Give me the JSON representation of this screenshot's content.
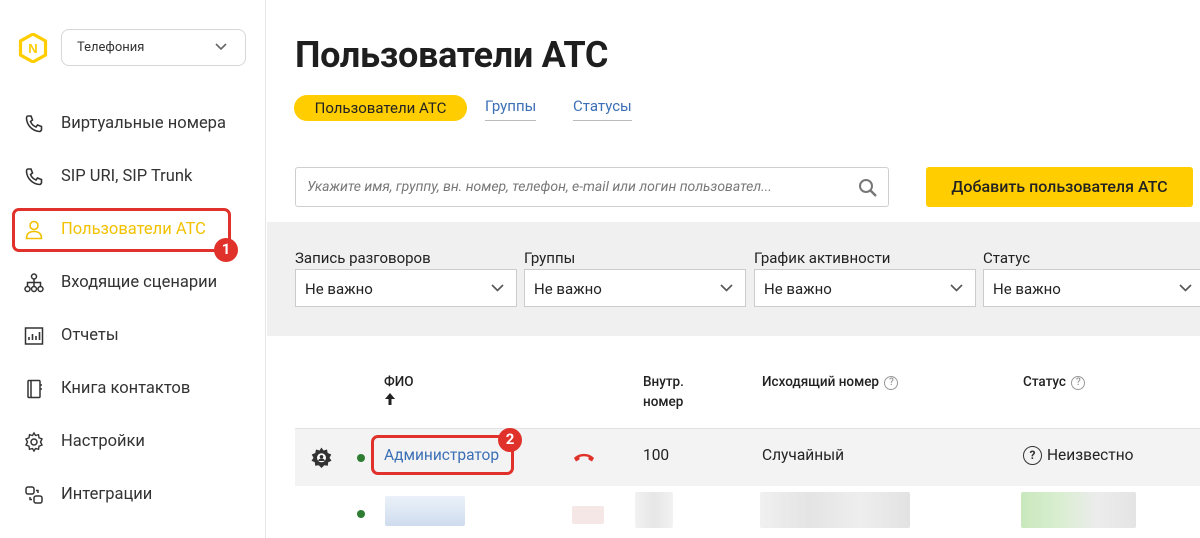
{
  "app": {
    "product_select": "Телефония",
    "page_title": "Пользователи АТС"
  },
  "sidebar": {
    "items": [
      {
        "label": "Виртуальные номера",
        "icon": "phone-icon"
      },
      {
        "label": "SIP URI, SIP Trunk",
        "icon": "phone-icon"
      },
      {
        "label": "Пользователи АТС",
        "icon": "user-icon",
        "active": true
      },
      {
        "label": "Входящие сценарии",
        "icon": "hierarchy-icon"
      },
      {
        "label": "Отчеты",
        "icon": "chart-icon"
      },
      {
        "label": "Книга контактов",
        "icon": "book-icon"
      },
      {
        "label": "Настройки",
        "icon": "gear-icon"
      },
      {
        "label": "Интеграции",
        "icon": "integration-icon"
      }
    ]
  },
  "tabs": [
    {
      "label": "Пользователи АТС",
      "active": true
    },
    {
      "label": "Группы"
    },
    {
      "label": "Статусы"
    }
  ],
  "search": {
    "placeholder": "Укажите имя, группу, вн. номер, телефон, e-mail или логин пользовател..."
  },
  "add_button": "Добавить пользователя АТС",
  "filters": [
    {
      "label": "Запись разговоров",
      "value": "Не важно"
    },
    {
      "label": "Группы",
      "value": "Не важно"
    },
    {
      "label": "График активности",
      "value": "Не важно"
    },
    {
      "label": "Статус",
      "value": "Не важно"
    }
  ],
  "table": {
    "columns": {
      "fio": "ФИО",
      "ext_line1": "Внутр.",
      "ext_line2": "номер",
      "outgoing": "Исходящий номер",
      "status": "Статус"
    },
    "rows": [
      {
        "name": "Администратор",
        "ext": "100",
        "outgoing": "Случайный",
        "status": "Неизвестно"
      }
    ]
  },
  "annotations": {
    "badge1": "1",
    "badge2": "2"
  },
  "colors": {
    "accent": "#ffcd00",
    "active_text": "#f2c200",
    "annotation_red": "#e0312b",
    "link": "#3b6fb6",
    "online_dot": "#2e7d32",
    "hangup": "#e0312b"
  }
}
